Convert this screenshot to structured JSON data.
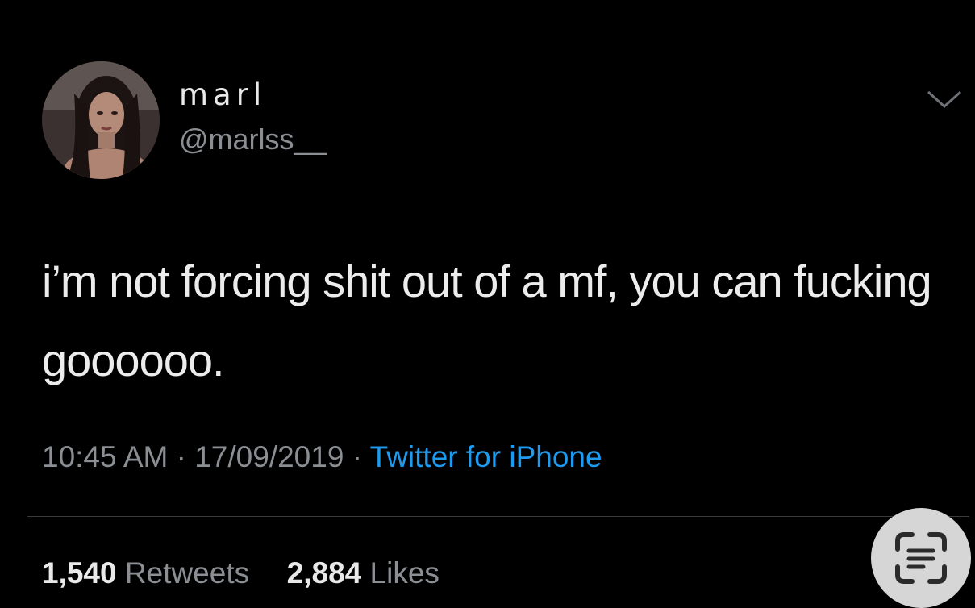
{
  "tweet": {
    "display_name": "marl",
    "handle": "@marlss__",
    "text": "i’m not forcing shit out of a mf, you can fucking goooooo.",
    "time": "10:45 AM",
    "separator": "·",
    "date": "17/09/2019",
    "source": "Twitter for iPhone",
    "retweets_count": "1,540",
    "retweets_label": "Retweets",
    "likes_count": "2,884",
    "likes_label": "Likes"
  },
  "icons": {
    "avatar": "profile-photo",
    "menu": "chevron-down-icon",
    "scan": "live-text-scan-icon"
  },
  "colors": {
    "background": "#000000",
    "text": "#e7e9ea",
    "secondary": "#8b8f93",
    "link": "#1d9bf0"
  }
}
